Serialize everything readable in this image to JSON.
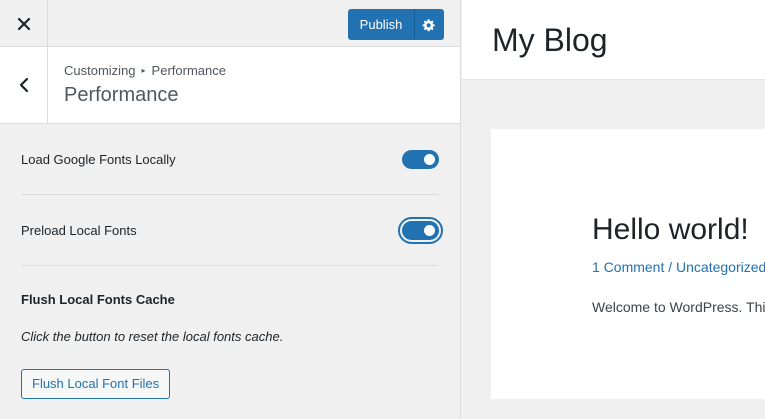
{
  "topbar": {
    "close_icon": "close-icon",
    "publish_label": "Publish",
    "gear_icon": "gear-icon"
  },
  "section": {
    "breadcrumb_root": "Customizing",
    "breadcrumb_current": "Performance",
    "title": "Performance",
    "back_icon": "chevron-left-icon"
  },
  "controls": [
    {
      "label": "Load Google Fonts Locally",
      "enabled": true
    },
    {
      "label": "Preload Local Fonts",
      "enabled": true
    }
  ],
  "flush": {
    "title": "Flush Local Fonts Cache",
    "description": "Click the button to reset the local fonts cache.",
    "button_label": "Flush Local Font Files"
  },
  "preview": {
    "site_title": "My Blog",
    "post_title": "Hello world!",
    "post_meta": "1 Comment / Uncategorized",
    "post_excerpt": "Welcome to WordPress. This is your first post."
  },
  "colors": {
    "accent": "#2271b1",
    "panel_bg": "#f0f0f1"
  }
}
